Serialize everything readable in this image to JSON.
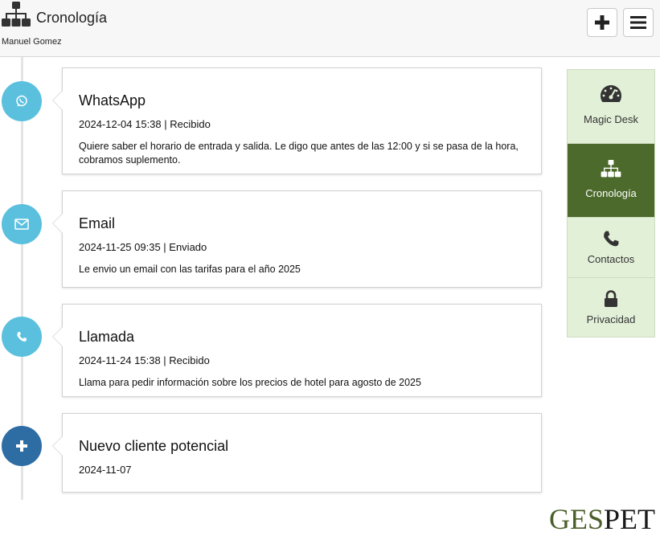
{
  "header": {
    "title": "Cronología",
    "user": "Manuel Gomez",
    "icons": {
      "title": "sitemap-icon",
      "add": "plus-icon",
      "menu": "hamburger-menu-icon"
    }
  },
  "timeline": [
    {
      "icon": "whatsapp-icon",
      "color": "#5bc0de",
      "title": "WhatsApp",
      "meta": "2024-12-04 15:38 | Recibido",
      "text": "Quiere saber el horario de entrada y salida. Le digo que antes de las 12:00 y si se pasa de la hora, cobramos suplemento."
    },
    {
      "icon": "envelope-icon",
      "color": "#5bc0de",
      "title": "Email",
      "meta": "2024-11-25 09:35 | Enviado",
      "text": "Le envio un email con las tarifas para el año 2025"
    },
    {
      "icon": "phone-icon",
      "color": "#5bc0de",
      "title": "Llamada",
      "meta": "2024-11-24 15:38 | Recibido",
      "text": "Llama para pedir información sobre los precios de hotel para agosto de 2025"
    },
    {
      "icon": "plus-icon",
      "color": "#2e6da4",
      "title": "Nuevo cliente potencial",
      "meta": "2024-11-07",
      "text": ""
    }
  ],
  "sidebar": {
    "items": [
      {
        "label": "Magic Desk",
        "icon": "dashboard-gauge-icon",
        "active": false
      },
      {
        "label": "Cronología",
        "icon": "sitemap-icon",
        "active": true
      },
      {
        "label": "Contactos",
        "icon": "phone-icon",
        "active": false
      },
      {
        "label": "Privacidad",
        "icon": "lock-icon",
        "active": false
      }
    ]
  },
  "logo": {
    "part1": "GES",
    "part2": "PET"
  },
  "colors": {
    "accent_green": "#4b6a2b",
    "sidebar_bg": "#e3f0d8",
    "dot_info": "#5bc0de",
    "dot_primary": "#2e6da4"
  }
}
